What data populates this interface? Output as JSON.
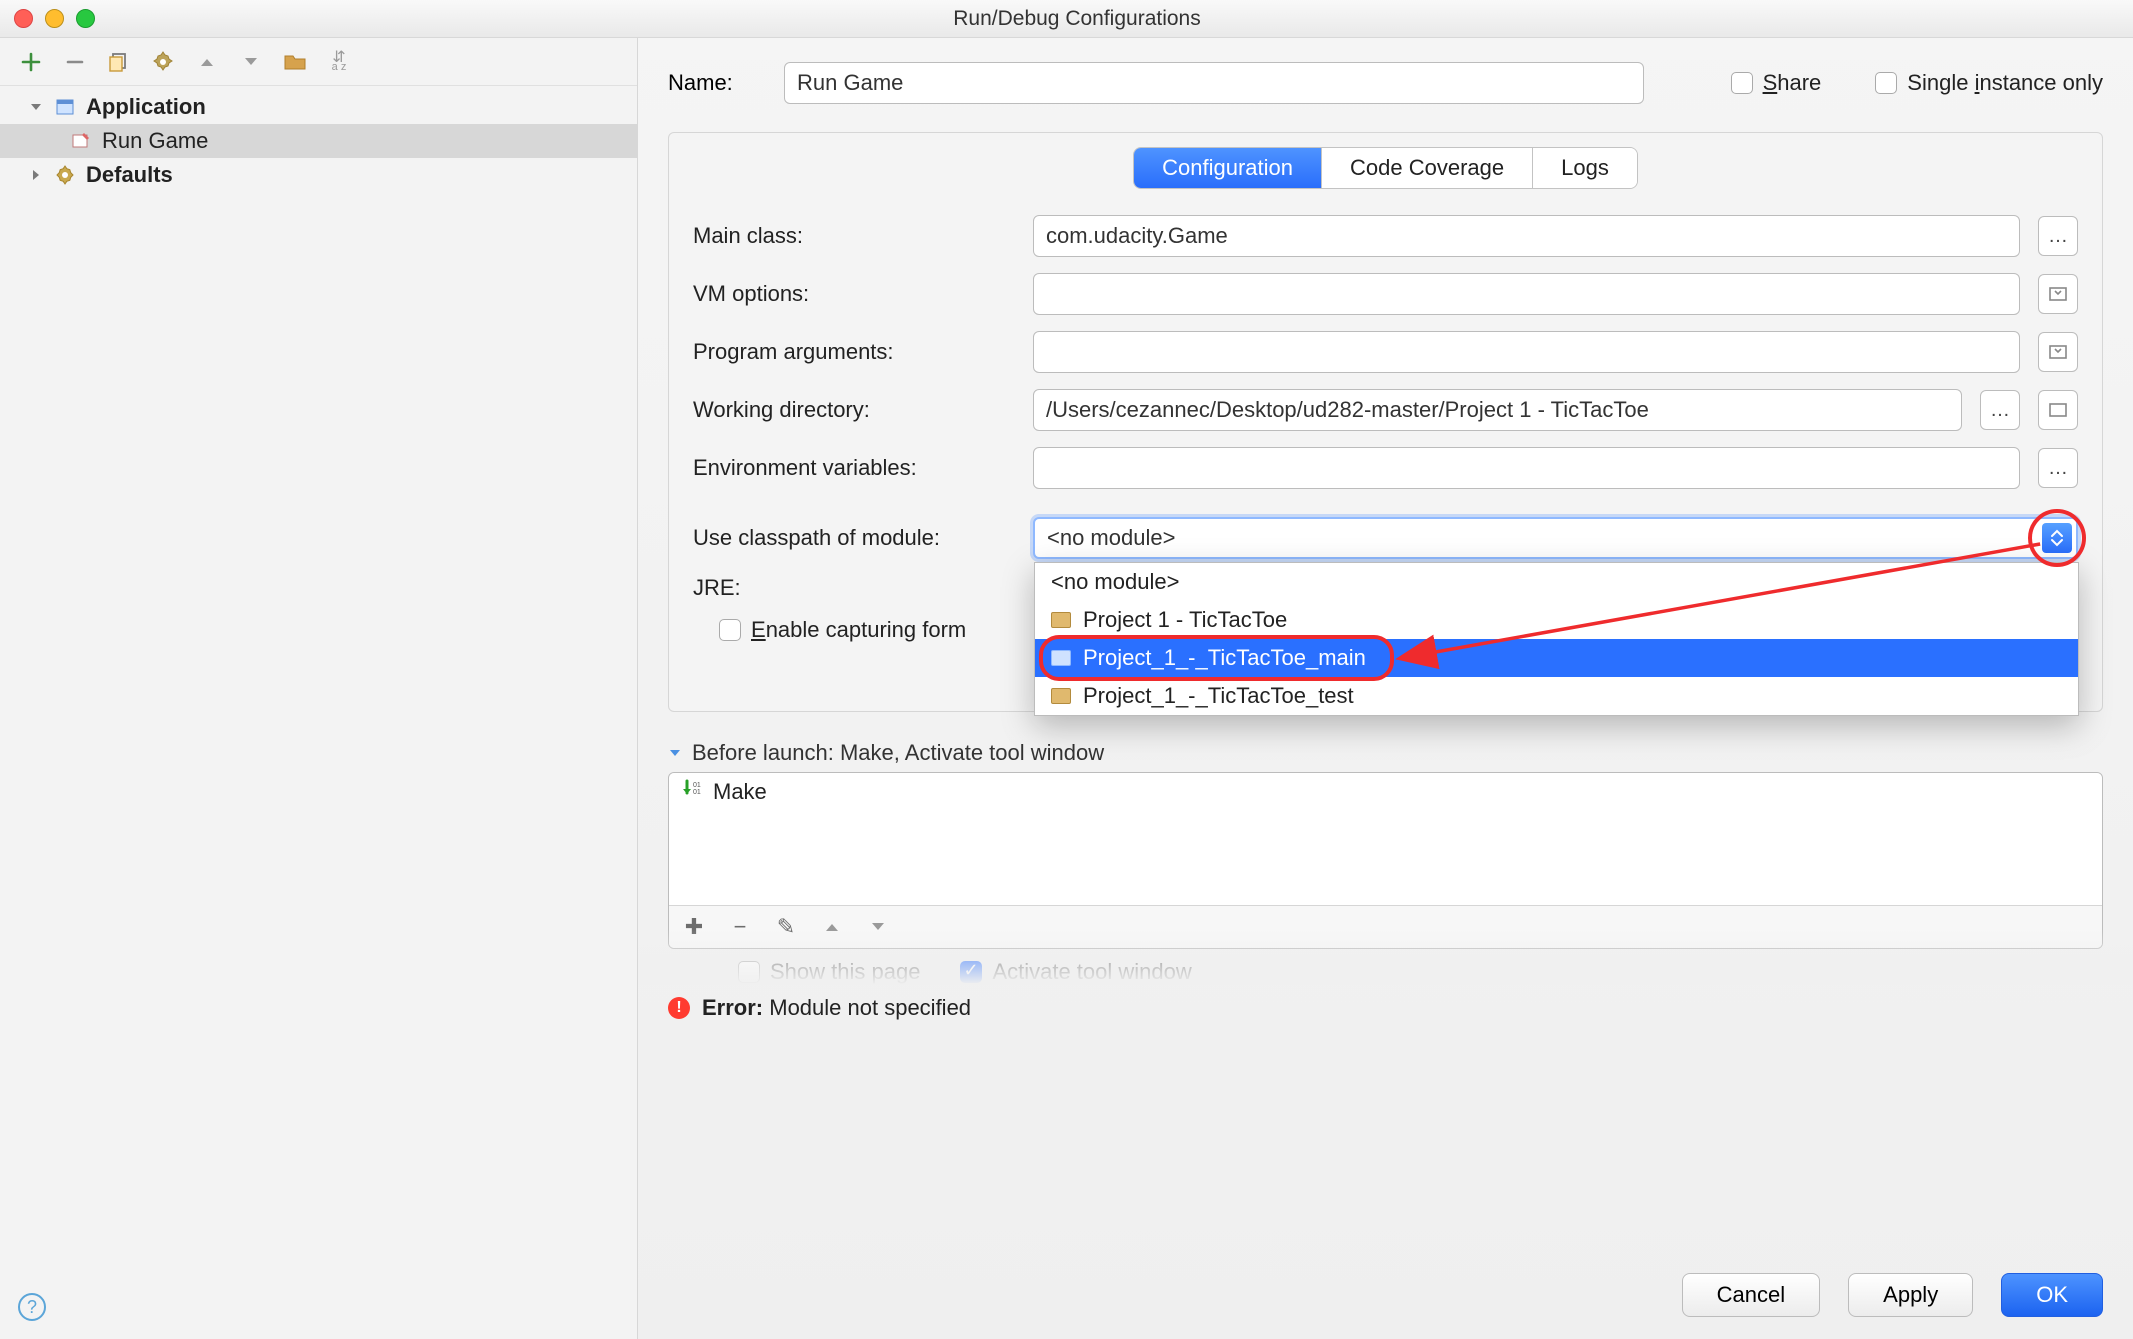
{
  "window": {
    "title": "Run/Debug Configurations"
  },
  "name_row": {
    "label": "Name:",
    "value": "Run Game",
    "share_label": "Share",
    "single_instance_label": "Single instance only"
  },
  "tree": {
    "application_label": "Application",
    "run_game_label": "Run Game",
    "defaults_label": "Defaults"
  },
  "tabs": {
    "configuration": "Configuration",
    "code_coverage": "Code Coverage",
    "logs": "Logs"
  },
  "form": {
    "main_class_label": "Main class:",
    "main_class_value": "com.udacity.Game",
    "vm_options_label": "VM options:",
    "vm_options_value": "",
    "program_args_label": "Program arguments:",
    "program_args_value": "",
    "working_dir_label": "Working directory:",
    "working_dir_value": "/Users/cezannec/Desktop/ud282-master/Project 1 - TicTacToe",
    "env_vars_label": "Environment variables:",
    "env_vars_value": "",
    "module_label": "Use classpath of module:",
    "module_value": "<no module>",
    "jre_label": "JRE:",
    "jre_value": "",
    "enable_capturing_label": "Enable capturing form"
  },
  "module_options": {
    "no_module": "<no module>",
    "p1": "Project 1 - TicTacToe",
    "p1_main": "Project_1_-_TicTacToe_main",
    "p1_test": "Project_1_-_TicTacToe_test"
  },
  "before_launch": {
    "header": "Before launch: Make, Activate tool window",
    "make_label": "Make"
  },
  "bottom_checks": {
    "show_this_page": "Show this page",
    "activate_tool_window": "Activate tool window"
  },
  "error": {
    "prefix": "Error:",
    "message": "Module not specified"
  },
  "footer": {
    "cancel": "Cancel",
    "apply": "Apply",
    "ok": "OK"
  }
}
